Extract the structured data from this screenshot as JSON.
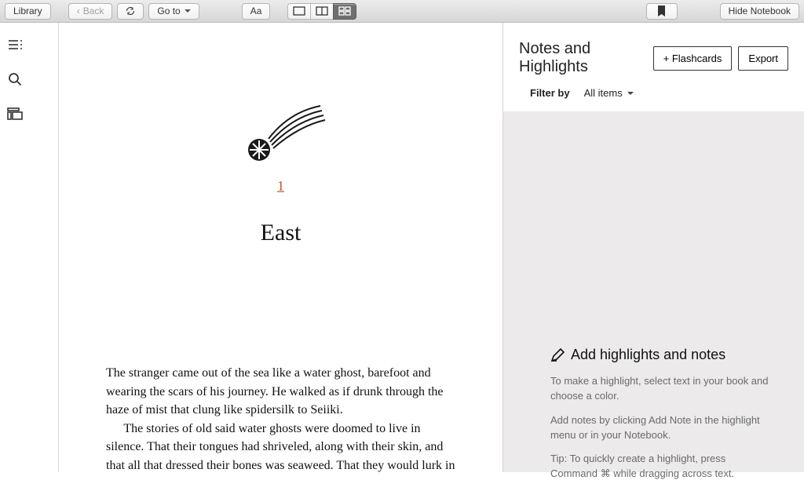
{
  "toolbar": {
    "library": "Library",
    "back": "Back",
    "goto": "Go to",
    "aa": "Aa",
    "hide_notebook": "Hide Notebook"
  },
  "chapter": {
    "number": "1",
    "title": "East",
    "paragraphs": [
      "The stranger came out of the sea like a water ghost, barefoot and wearing the scars of his journey. He walked as if drunk through the haze of mist that clung like spidersilk to Seiiki.",
      "The stories of old said water ghosts were doomed to live in silence. That their tongues had shriveled, along with their skin, and that all that dressed their bones was seaweed. That they would lurk in the shallows, waiting to drag the unwary to the heart of the Abyss."
    ]
  },
  "sidepanel": {
    "title": "Notes and Highlights",
    "flashcards": "+ Flashcards",
    "export": "Export",
    "filter_label": "Filter by",
    "filter_value": "All items",
    "empty": {
      "heading": "Add highlights and notes",
      "p1": "To make a highlight, select text in your book and choose a color.",
      "p2": "Add notes by clicking Add Note in the highlight menu or in your Notebook.",
      "p3": "Tip: To quickly create a highlight, press Command ⌘ while dragging across text."
    }
  }
}
